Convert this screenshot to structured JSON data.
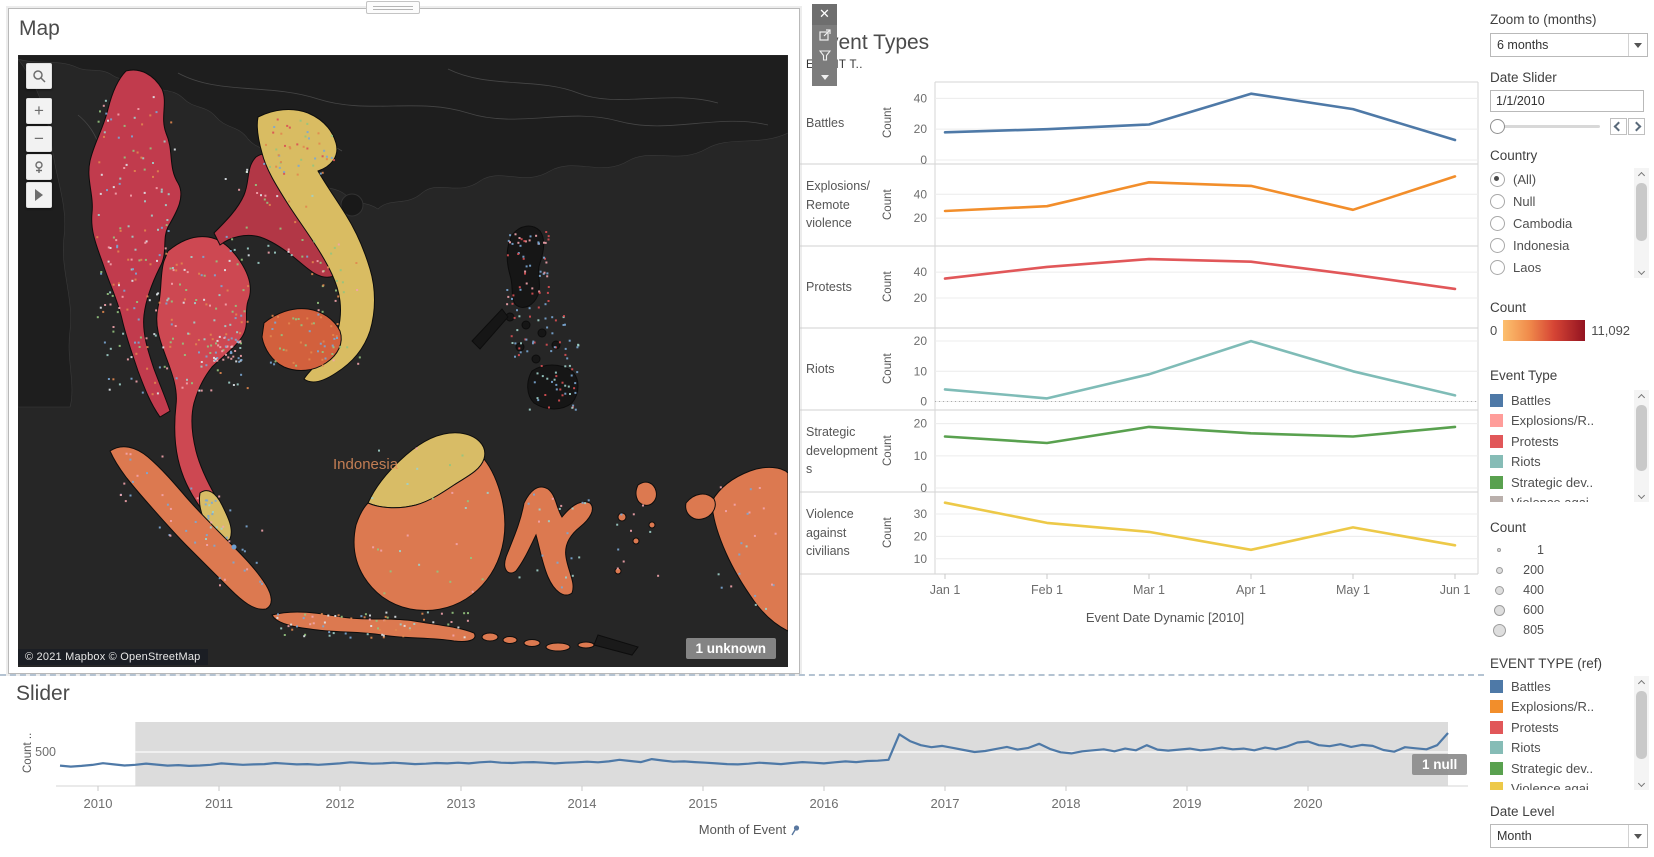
{
  "map_panel": {
    "title": "Map",
    "attribution": "© 2021 Mapbox © OpenStreetMap",
    "badge": "1 unknown",
    "country_label": "Indonesia",
    "controls": [
      "search",
      "zoom-in",
      "zoom-out",
      "pin",
      "pan"
    ],
    "country_colors": {
      "Myanmar": "#c13b4d",
      "Thailand": "#cd4852",
      "Laos": "#b23746",
      "Vietnam": "#d9bc62",
      "Cambodia": "#d2603d",
      "Malaysia": "#d8bc66",
      "Indonesia": "#dc7950"
    }
  },
  "toolbar": {
    "close": "✕"
  },
  "event_types_panel": {
    "title": "Event Types",
    "column_header": "EVENT T..",
    "row_axis_label": "Count",
    "x_axis_title": "Event Date Dynamic [2010]",
    "chart_data": {
      "type": "line",
      "small_multiples": true,
      "x_labels": [
        "Jan 1",
        "Feb 1",
        "Mar 1",
        "Apr 1",
        "May 1",
        "Jun 1"
      ],
      "xlabel": "Event Date Dynamic [2010]",
      "ylabel": "Count",
      "series": [
        {
          "name": "Battles",
          "color": "#4e79a7",
          "values": [
            18,
            20,
            23,
            43,
            33,
            13
          ],
          "ticks": [
            0,
            20,
            40
          ],
          "ylim": [
            0,
            48
          ]
        },
        {
          "name": "Explosions/Remote violence",
          "color": "#f28e2b",
          "values": [
            26,
            30,
            50,
            47,
            27,
            55
          ],
          "ticks": [
            20,
            40
          ],
          "ylim": [
            0,
            62
          ]
        },
        {
          "name": "Protests",
          "color": "#e15759",
          "values": [
            35,
            44,
            50,
            48,
            38,
            27
          ],
          "ticks": [
            20,
            40
          ],
          "ylim": [
            0,
            57
          ]
        },
        {
          "name": "Riots",
          "color": "#7fbcb7",
          "values": [
            4,
            1,
            9,
            20,
            10,
            2
          ],
          "ticks": [
            0,
            10,
            20
          ],
          "ylim": [
            -1.5,
            23
          ],
          "zero_line": true
        },
        {
          "name": "Strategic developments",
          "color": "#59a14f",
          "values": [
            16,
            14,
            19,
            17,
            16,
            19
          ],
          "ticks": [
            0,
            10,
            20
          ],
          "ylim": [
            0,
            23
          ]
        },
        {
          "name": "Violence against civilians",
          "color": "#edc948",
          "values": [
            35,
            26,
            22,
            14,
            24,
            16
          ],
          "ticks": [
            10,
            20,
            30
          ],
          "ylim": [
            5,
            38
          ]
        }
      ]
    }
  },
  "sidebar": {
    "zoom_to": {
      "label": "Zoom to (months)",
      "value": "6 months"
    },
    "date_slider": {
      "label": "Date Slider",
      "value": "1/1/2010"
    },
    "country": {
      "label": "Country",
      "options": [
        "(All)",
        "Null",
        "Cambodia",
        "Indonesia",
        "Laos"
      ],
      "selected": "(All)"
    },
    "count_color": {
      "label": "Count",
      "min": "0",
      "max": "11,092"
    },
    "event_type_legend": {
      "label": "Event Type",
      "items": [
        {
          "label": "Battles",
          "color": "#4e79a7"
        },
        {
          "label": "Explosions/R..",
          "color": "#ff9d9a"
        },
        {
          "label": "Protests",
          "color": "#e15759"
        },
        {
          "label": "Riots",
          "color": "#86bcb6"
        },
        {
          "label": "Strategic dev..",
          "color": "#59a14f"
        },
        {
          "label": "Violence agai..",
          "color": "#bab0ac"
        }
      ]
    },
    "count_size": {
      "label": "Count",
      "items": [
        "1",
        "200",
        "400",
        "600",
        "805"
      ]
    },
    "event_type_ref_legend": {
      "label": "EVENT TYPE (ref)",
      "items": [
        {
          "label": "Battles",
          "color": "#4e79a7"
        },
        {
          "label": "Explosions/R..",
          "color": "#f28e2b"
        },
        {
          "label": "Protests",
          "color": "#e15759"
        },
        {
          "label": "Riots",
          "color": "#86bcb6"
        },
        {
          "label": "Strategic dev..",
          "color": "#59a14f"
        },
        {
          "label": "Violence agai..",
          "color": "#edc948"
        }
      ]
    },
    "date_level": {
      "label": "Date Level",
      "value": "Month"
    }
  },
  "slider_panel": {
    "title": "Slider",
    "y_axis_label": "Count ..",
    "y_tick": "500",
    "x_axis_title": "Month of Event",
    "badge": "1 null",
    "chart_data": {
      "type": "line",
      "line_color": "#4e79a7",
      "x_ticks": [
        "2010",
        "2011",
        "2012",
        "2013",
        "2014",
        "2015",
        "2016",
        "2017",
        "2018",
        "2019",
        "2020"
      ],
      "y_ticks": [
        500
      ],
      "selection_start_index": 7,
      "values": [
        300,
        285,
        295,
        310,
        335,
        318,
        302,
        312,
        330,
        315,
        300,
        308,
        295,
        302,
        312,
        332,
        322,
        312,
        318,
        322,
        338,
        328,
        318,
        322,
        312,
        322,
        332,
        348,
        338,
        328,
        332,
        342,
        332,
        322,
        328,
        338,
        332,
        342,
        332,
        348,
        358,
        342,
        338,
        348,
        352,
        342,
        332,
        342,
        348,
        358,
        348,
        362,
        385,
        368,
        352,
        395,
        375,
        358,
        362,
        352,
        342,
        332,
        322,
        318,
        328,
        342,
        332,
        322,
        338,
        352,
        342,
        332,
        348,
        362,
        352,
        368,
        372,
        385,
        760,
        660,
        600,
        570,
        590,
        560,
        530,
        500,
        515,
        545,
        575,
        535,
        560,
        620,
        545,
        495,
        480,
        510,
        525,
        540,
        510,
        550,
        525,
        600,
        535,
        520,
        535,
        550,
        525,
        540,
        565,
        540,
        550,
        525,
        565,
        540,
        580,
        640,
        655,
        600,
        585,
        615,
        575,
        605,
        590,
        530,
        505,
        570,
        555,
        540,
        600,
        780
      ]
    }
  }
}
